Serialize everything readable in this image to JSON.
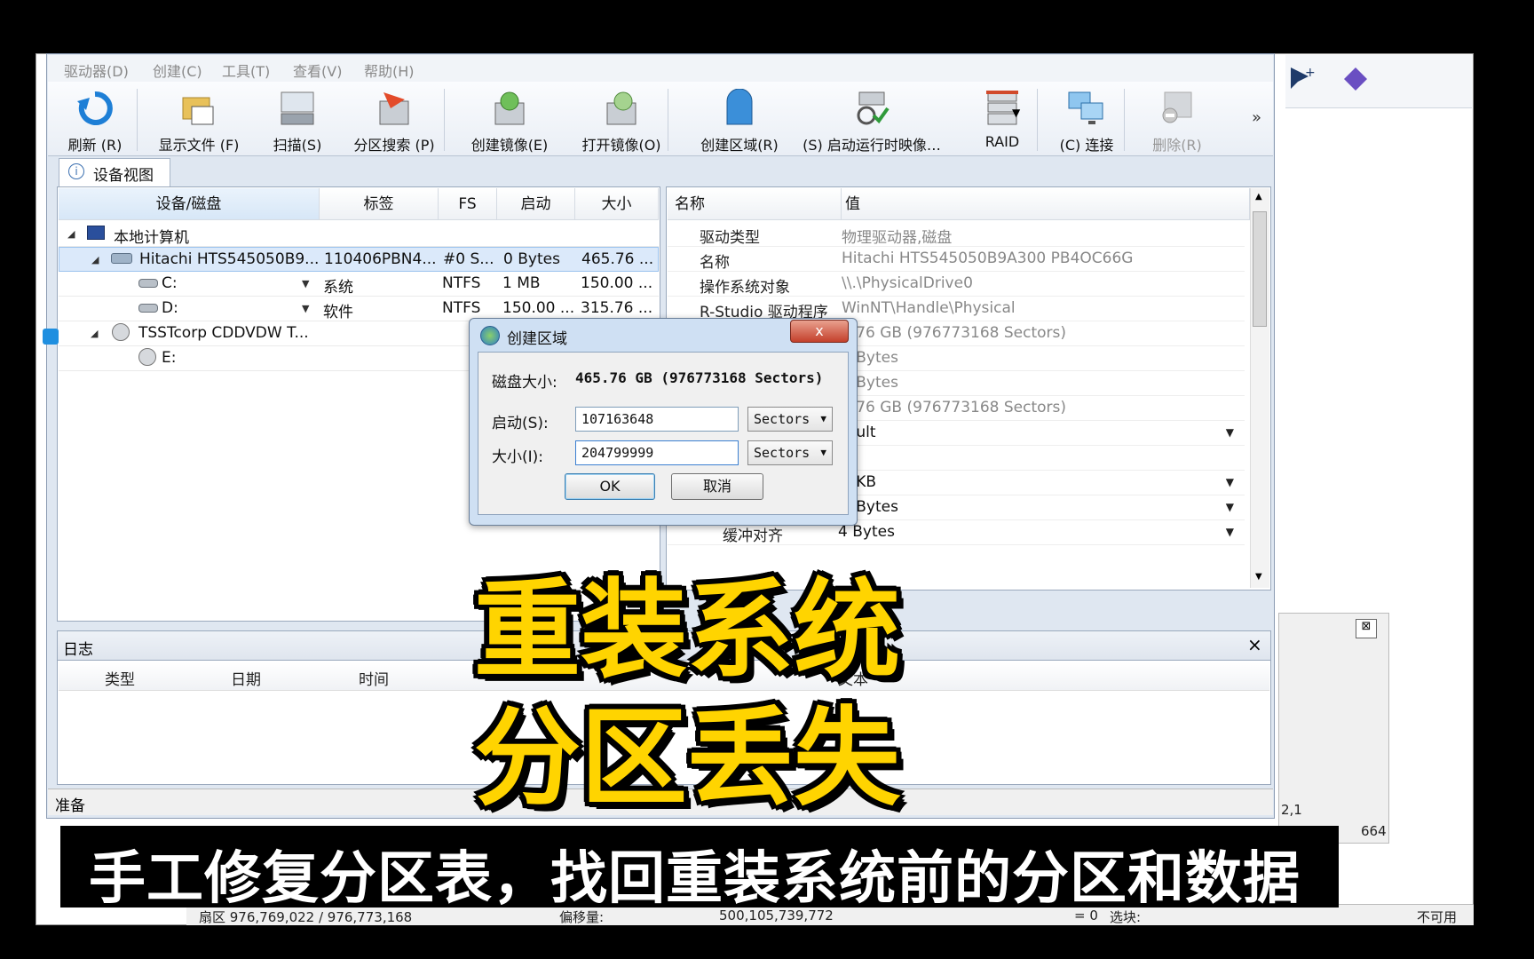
{
  "menu": [
    "驱动器(D)",
    "创建(C)",
    "工具(T)",
    "查看(V)",
    "帮助(H)"
  ],
  "toolbar": {
    "refresh": "刷新 (R)",
    "show_files": "显示文件 (F)",
    "scan": "扫描(S)",
    "partition_search": "分区搜索 (P)",
    "create_image": "创建镜像(E)",
    "open_image": "打开镜像(O)",
    "create_region": "创建区域(R)",
    "startup_image": "(S) 启动运行时映像…",
    "raid": "RAID",
    "connect": "(C) 连接",
    "delete": "删除(R)",
    "more": "»"
  },
  "tab": {
    "device_view": "设备视图"
  },
  "tree": {
    "columns": [
      "设备/磁盘",
      "标签",
      "FS",
      "启动",
      "大小"
    ],
    "rows": [
      {
        "name": "本地计算机",
        "label": "",
        "fs": "",
        "start": "",
        "size": ""
      },
      {
        "name": "Hitachi HTS545050B9...",
        "label": "110406PBN4...",
        "fs": "#0 S...",
        "start": "0 Bytes",
        "size": "465.76 ..."
      },
      {
        "name": "C:",
        "label": "系统",
        "fs": "NTFS",
        "start": "1 MB",
        "size": "150.00 ..."
      },
      {
        "name": "D:",
        "label": "软件",
        "fs": "NTFS",
        "start": "150.00 ...",
        "size": "315.76 ..."
      },
      {
        "name": "TSSTcorp CDDVDW T...",
        "label": "",
        "fs": "",
        "start": "",
        "size": ""
      },
      {
        "name": "E:",
        "label": "",
        "fs": "",
        "start": "",
        "size": ""
      }
    ]
  },
  "props": {
    "columns": [
      "名称",
      "值"
    ],
    "rows": [
      {
        "name": "驱动类型",
        "value": "物理驱动器,磁盘"
      },
      {
        "name": "名称",
        "value": "Hitachi HTS545050B9A300 PB4OC66G"
      },
      {
        "name": "操作系统对象",
        "value": "\\\\.\\PhysicalDrive0"
      },
      {
        "name": "R-Studio 驱动程序",
        "value": "WinNT\\Handle\\Physical"
      },
      {
        "name": "",
        "value": "5.76 GB (976773168 Sectors)"
      },
      {
        "name": "",
        "value": "2 Bytes"
      },
      {
        "name": "",
        "value": "2 Bytes"
      },
      {
        "name": "",
        "value": "5.76 GB (976773168 Sectors)"
      },
      {
        "name": "",
        "value": "fault"
      },
      {
        "name": "",
        "value": ""
      },
      {
        "name": "",
        "value": "8 KB"
      },
      {
        "name": "",
        "value": "2 Bytes"
      },
      {
        "name": "缓冲对齐",
        "value": "4 Bytes"
      }
    ]
  },
  "log": {
    "title": "日志",
    "close": "×",
    "columns": [
      "类型",
      "日期",
      "时间",
      "文本"
    ]
  },
  "status": {
    "ready": "准备"
  },
  "bg_status": {
    "sector": "扇区 976,769,022 / 976,773,168",
    "offset_label": "偏移量:",
    "offset_value": "500,105,739,772",
    "eq": "= 0",
    "selection": "选块:",
    "unavailable": "不可用",
    "side1": "2,1",
    "side2": "664"
  },
  "dialog": {
    "title": "创建区域",
    "close": "x",
    "disk_size_label": "磁盘大小:",
    "disk_size_value": "465.76 GB (976773168 Sectors)",
    "start_label": "启动(S):",
    "start_value": "107163648",
    "start_unit": "Sectors",
    "size_label": "大小(I):",
    "size_value": "204799999",
    "size_unit": "Sectors",
    "ok": "OK",
    "cancel": "取消"
  },
  "captions": {
    "line1": "重装系统",
    "line2": "分区丢失",
    "subtitle": "手工修复分区表，找回重装系统前的分区和数据"
  }
}
